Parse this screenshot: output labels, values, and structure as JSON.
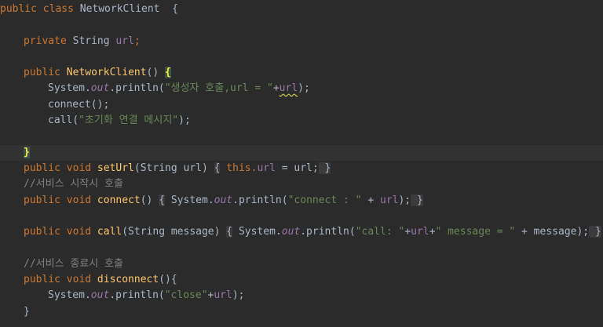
{
  "code": {
    "l1": {
      "kw": "public class ",
      "name": "NetworkClient",
      "rest": "  {"
    },
    "l3": {
      "kw": "private ",
      "type": "String ",
      "field": "url",
      "semi": ";"
    },
    "l5": {
      "kw": "public ",
      "fn": "NetworkClient",
      "paren": "() ",
      "brace": "{"
    },
    "l6": {
      "a": "System.",
      "b": "out",
      "c": ".println(",
      "s": "\"생성자 호출,url = \"",
      "d": "+",
      "f": "url",
      "e": ");"
    },
    "l7": {
      "a": "connect();"
    },
    "l8": {
      "a": "call(",
      "s": "\"초기화 연결 메시지\"",
      "e": ");"
    },
    "l10": {
      "brace": "}"
    },
    "l11": {
      "kw": "public void ",
      "fn": "setUrl",
      "a": "(String url) ",
      "ob": "{",
      "kw2": " this",
      "dot": ".",
      "f": "url",
      "b": " = url;",
      "cb": " }"
    },
    "l12": {
      "cm": "//서비스 시작시 호출"
    },
    "l13": {
      "kw": "public void ",
      "fn": "connect",
      "a": "() ",
      "ob": "{",
      "b": " System.",
      "st": "out",
      "c": ".println(",
      "s": "\"connect : \"",
      "d": " + ",
      "f": "url",
      "e": ");",
      "cb": " }"
    },
    "l15": {
      "kw": "public void ",
      "fn": "call",
      "a": "(String message) ",
      "ob": "{",
      "b": " System.",
      "st": "out",
      "c": ".println(",
      "s1": "\"call: \"",
      "p1": "+",
      "f": "url",
      "p2": "+",
      "s2": "\" message = \"",
      "d": " + message);",
      "cb": " }"
    },
    "l17": {
      "cm": "//서비스 종료시 호출"
    },
    "l18": {
      "kw": "public void ",
      "fn": "disconnect",
      "a": "(){"
    },
    "l19": {
      "a": "System.",
      "st": "out",
      "c": ".println(",
      "s": "\"close\"",
      "p": "+",
      "f": "url",
      "e": ");"
    },
    "l20": {
      "brace": "}"
    }
  }
}
